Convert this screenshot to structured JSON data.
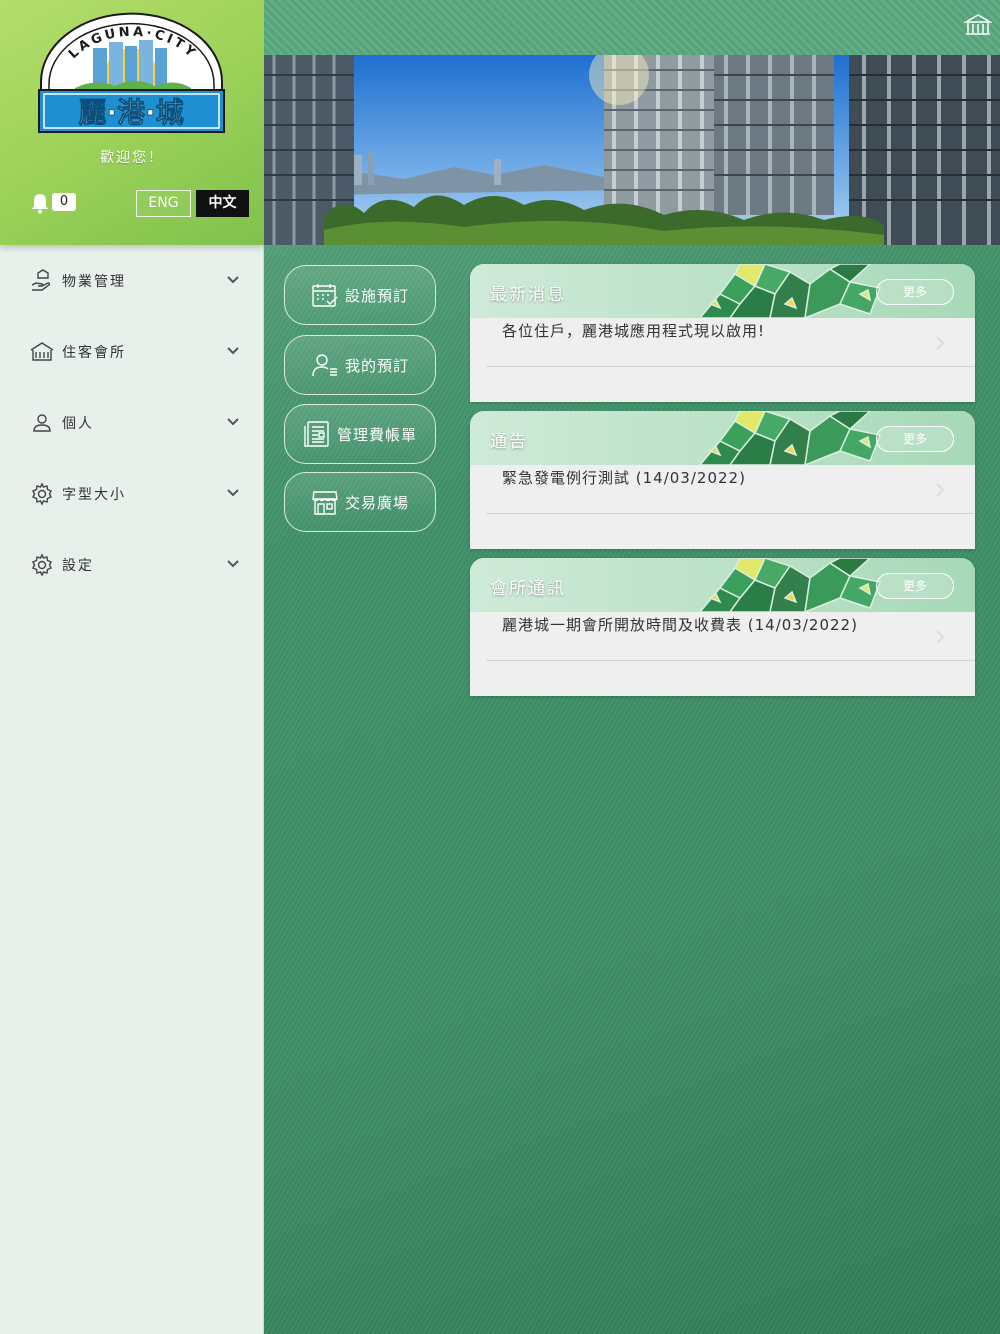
{
  "sidebar": {
    "logo": {
      "arc_text": "LAGUNA·CITY",
      "title": "麗·港·城"
    },
    "welcome": "歡迎您！",
    "notification_count": "0",
    "lang_eng": "ENG",
    "lang_zh": "中文",
    "menu": [
      {
        "label": "物業管理",
        "icon": "hand-house-icon"
      },
      {
        "label": "住客會所",
        "icon": "clubhouse-icon"
      },
      {
        "label": "個人",
        "icon": "person-icon"
      },
      {
        "label": "字型大小",
        "icon": "gear-icon"
      },
      {
        "label": "設定",
        "icon": "gear-icon"
      }
    ]
  },
  "main": {
    "quick_actions": [
      {
        "label": "設施預訂",
        "icon": "calendar-icon"
      },
      {
        "label": "我的預訂",
        "icon": "person-list-icon"
      },
      {
        "label": "管理費帳單",
        "icon": "bill-icon"
      },
      {
        "label": "交易廣場",
        "icon": "store-icon"
      }
    ],
    "cards": [
      {
        "title": "最新消息",
        "more": "更多",
        "item": "各位住戶，麗港城應用程式現以啟用!"
      },
      {
        "title": "通告",
        "more": "更多",
        "item": "緊急發電例行測試 (14/03/2022)"
      },
      {
        "title": "會所通訊",
        "more": "更多",
        "item": "麗港城一期會所開放時間及收費表 (14/03/2022)"
      }
    ]
  },
  "colors": {
    "accent_green": "#3f9068",
    "header_lime": "#9fd35a",
    "logo_blue": "#1e8fd0"
  }
}
